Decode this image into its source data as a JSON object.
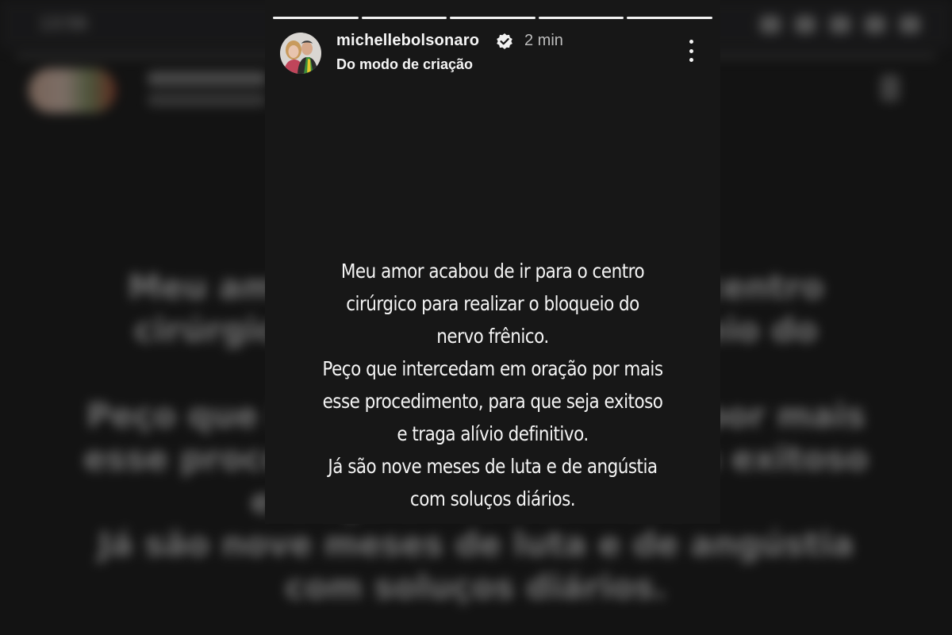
{
  "background": {
    "time": "13:56"
  },
  "story": {
    "username": "michellebolsonaro",
    "posted_time": "2 min",
    "subtitle": "Do modo de criação",
    "segments": 5,
    "message": "Meu amor acabou de ir para o centro\ncirúrgico para realizar o bloqueio do\nnervo frênico.\nPeço que intercedam em oração por mais\nesse procedimento, para que seja exitoso\ne traga alívio definitivo.\nJá são nove meses de luta e de angústia\ncom soluços diários.",
    "icons": {
      "verified": "verified-badge-icon",
      "more": "more-options-icon"
    }
  }
}
